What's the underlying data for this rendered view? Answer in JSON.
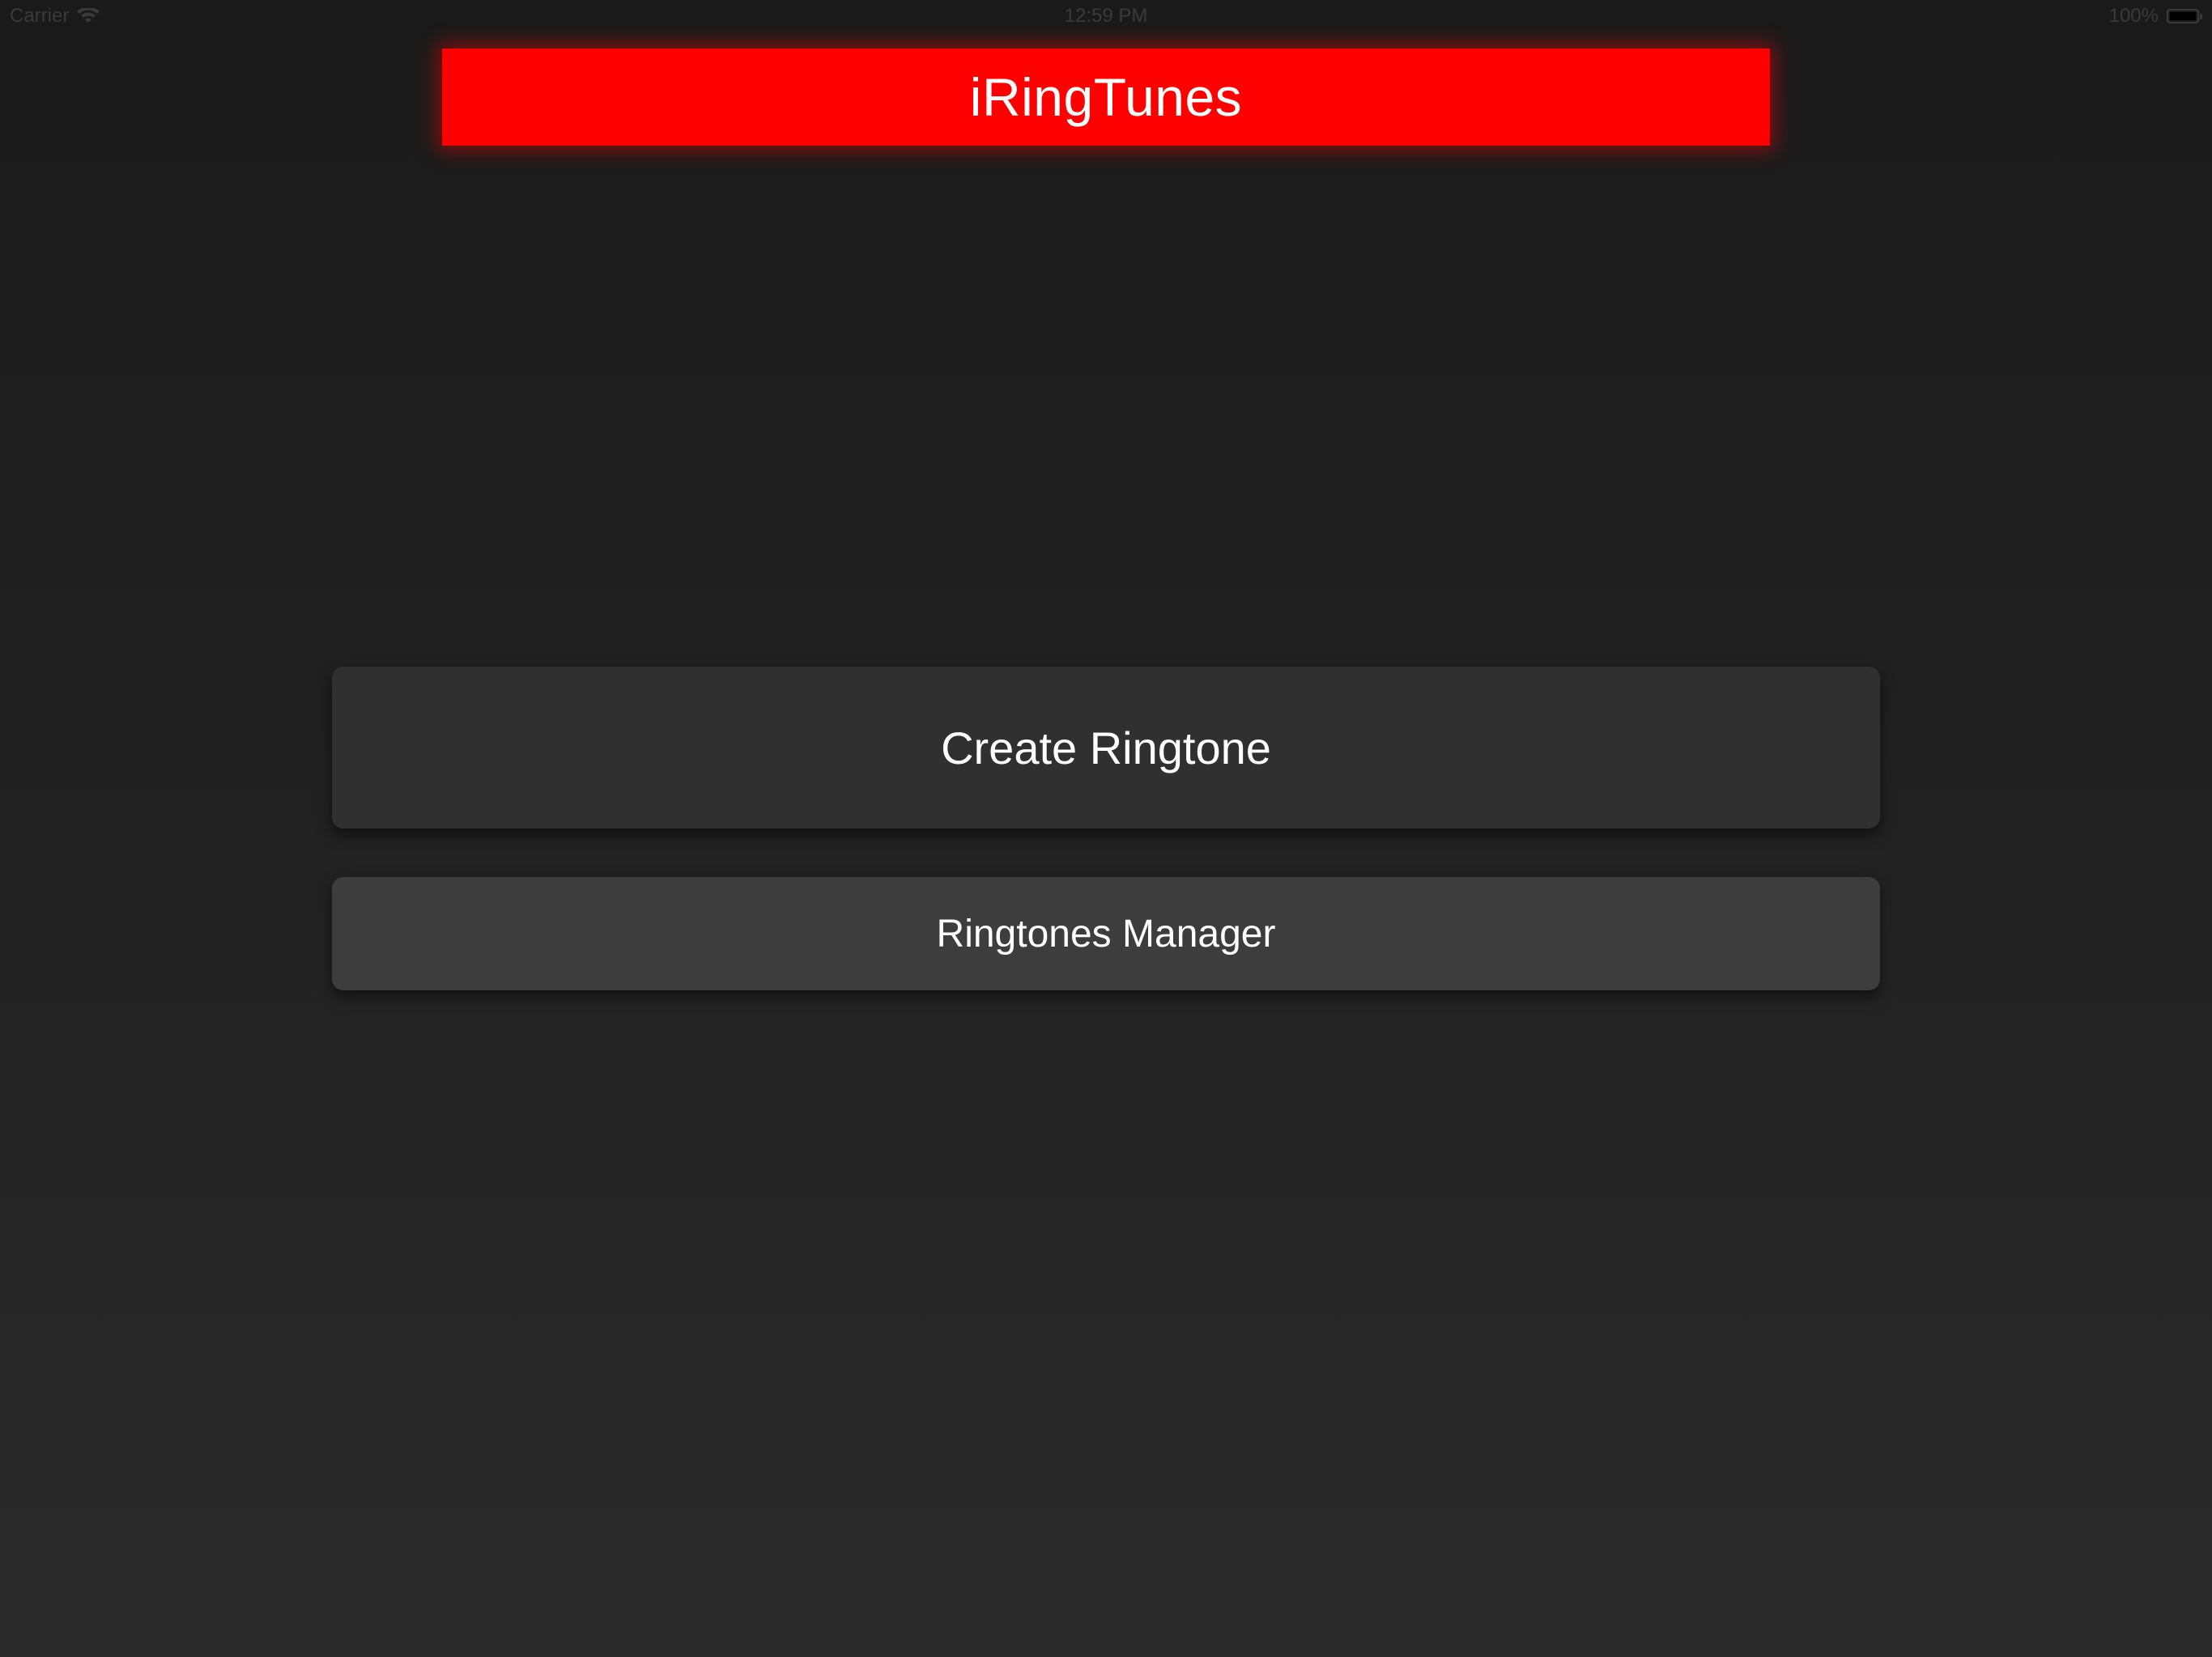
{
  "status_bar": {
    "carrier": "Carrier",
    "time": "12:59 PM",
    "battery_percent": "100%",
    "battery_level": 1.0,
    "icons": {
      "wifi": "wifi-icon",
      "battery": "battery-icon"
    }
  },
  "header": {
    "title": "iRingTunes",
    "color": "#ff0000"
  },
  "menu": {
    "create_label": "Create Ringtone",
    "manager_label": "Ringtones Manager"
  },
  "colors": {
    "accent": "#ff0000",
    "button_primary": "#303030",
    "button_secondary": "#3d3d3d",
    "background": "#1f1f1f"
  }
}
